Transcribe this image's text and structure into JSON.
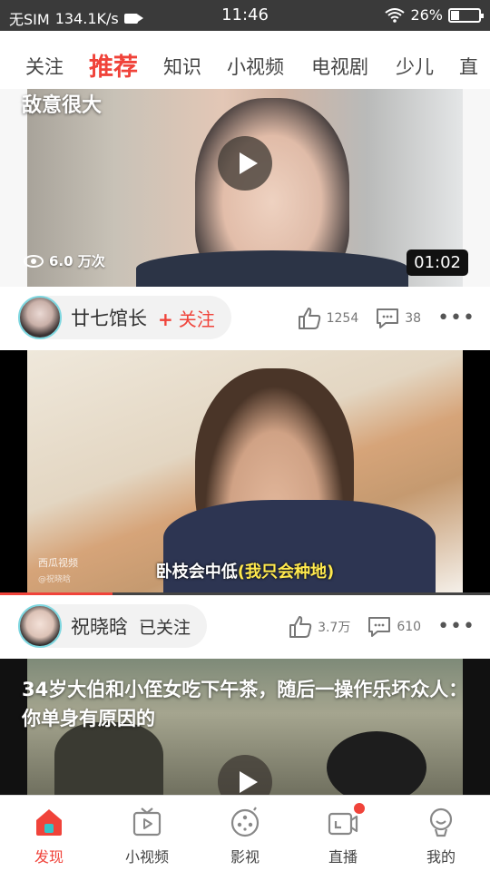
{
  "status_bar": {
    "carrier": "无SIM",
    "speed": "134.1K/s",
    "time": "11:46",
    "battery": "26%"
  },
  "tabs": [
    "关注",
    "推荐",
    "知识",
    "小视频",
    "电视剧",
    "少儿",
    "直"
  ],
  "active_tab_index": 1,
  "feed": [
    {
      "title": "敌意很大",
      "views": "6.0 万次",
      "duration": "01:02",
      "author": "廿七馆长",
      "follow_label": "关注",
      "follow_prefix": "+",
      "likes": "1254",
      "comments": "38"
    },
    {
      "subtitle_white": "卧枝会中低",
      "subtitle_yellow": "(我只会种地)",
      "watermark": "西瓜视频",
      "watermark_sub": "@祝晓晗",
      "progress_fraction": 0.23,
      "author": "祝晓晗",
      "follow_label": "已关注",
      "likes": "3.7万",
      "comments": "610"
    },
    {
      "title": "34岁大伯和小侄女吃下午茶，随后一操作乐坏众人：你单身有原因的"
    }
  ],
  "more_label": "•••",
  "colors": {
    "accent": "#f0433a",
    "status_bar": "#3a3a3a"
  },
  "bottom_nav": [
    {
      "label": "发现",
      "icon": "home-icon",
      "active": true
    },
    {
      "label": "小视频",
      "icon": "tv-icon"
    },
    {
      "label": "影视",
      "icon": "film-reel-icon"
    },
    {
      "label": "直播",
      "icon": "live-camera-icon",
      "badge": true
    },
    {
      "label": "我的",
      "icon": "profile-icon"
    }
  ]
}
